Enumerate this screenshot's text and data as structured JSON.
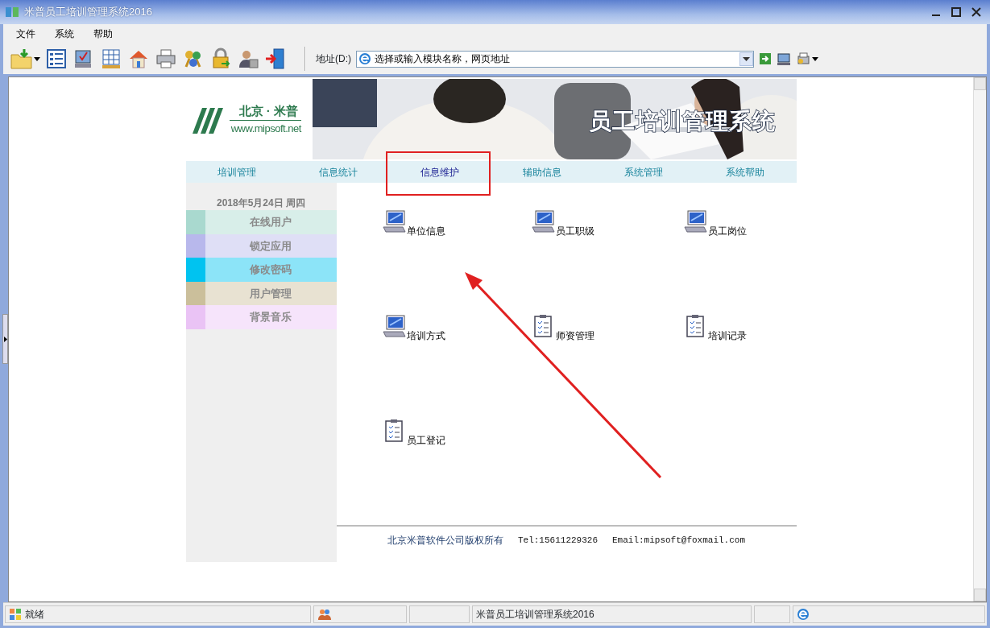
{
  "window": {
    "title": "米普员工培训管理系统2016"
  },
  "menu": [
    "文件",
    "系统",
    "帮助"
  ],
  "toolbar": {
    "tools": [
      {
        "kind": "folder",
        "dropdown": true
      },
      {
        "kind": "list",
        "dropdown": false
      },
      {
        "kind": "computer",
        "dropdown": false
      },
      {
        "kind": "table",
        "dropdown": false
      },
      {
        "kind": "home",
        "dropdown": false
      },
      {
        "kind": "printer",
        "dropdown": false
      },
      {
        "kind": "keys",
        "dropdown": false
      },
      {
        "kind": "lock",
        "dropdown": false
      },
      {
        "kind": "userlock",
        "dropdown": false
      },
      {
        "kind": "exit",
        "dropdown": false
      }
    ],
    "address_label": "地址(D:)",
    "address_value": "选择或输入模块名称，网页地址"
  },
  "header": {
    "logo_city": "北京 · 米普",
    "logo_site": "www.mipsoft.net",
    "banner_title": "员工培训管理系统"
  },
  "nav": [
    {
      "label": "培训管理",
      "selected": false
    },
    {
      "label": "信息统计",
      "selected": false
    },
    {
      "label": "信息维护",
      "selected": true
    },
    {
      "label": "辅助信息",
      "selected": false
    },
    {
      "label": "系统管理",
      "selected": false
    },
    {
      "label": "系统帮助",
      "selected": false
    }
  ],
  "sidebar": {
    "date": "2018年5月24日  周四",
    "items": [
      {
        "label": "在线用户",
        "color": "#a9d9cf"
      },
      {
        "label": "锁定应用",
        "color": "#b8b8ec"
      },
      {
        "label": "修改密码",
        "color": "#00c3f0"
      },
      {
        "label": "用户管理",
        "color": "#cbbf9b"
      },
      {
        "label": "背景音乐",
        "color": "#eac3f5"
      }
    ]
  },
  "modules": [
    {
      "label": "单位信息",
      "kind": "monitor"
    },
    {
      "label": "员工职级",
      "kind": "monitor"
    },
    {
      "label": "员工岗位",
      "kind": "monitor"
    },
    {
      "label": "培训方式",
      "kind": "monitor"
    },
    {
      "label": "师资管理",
      "kind": "clipboard"
    },
    {
      "label": "培训记录",
      "kind": "clipboard"
    },
    {
      "label": "员工登记",
      "kind": "clipboard"
    }
  ],
  "footer": {
    "company": "北京米普软件公司版权所有",
    "tel": "Tel:15611229326",
    "email": "Email:mipsoft@foxmail.com"
  },
  "annotations": [
    {
      "kind": "highlight-box"
    },
    {
      "kind": "arrow"
    }
  ],
  "status_bar": {
    "ready": "就绪",
    "app_name": "米普员工培训管理系统2016"
  }
}
